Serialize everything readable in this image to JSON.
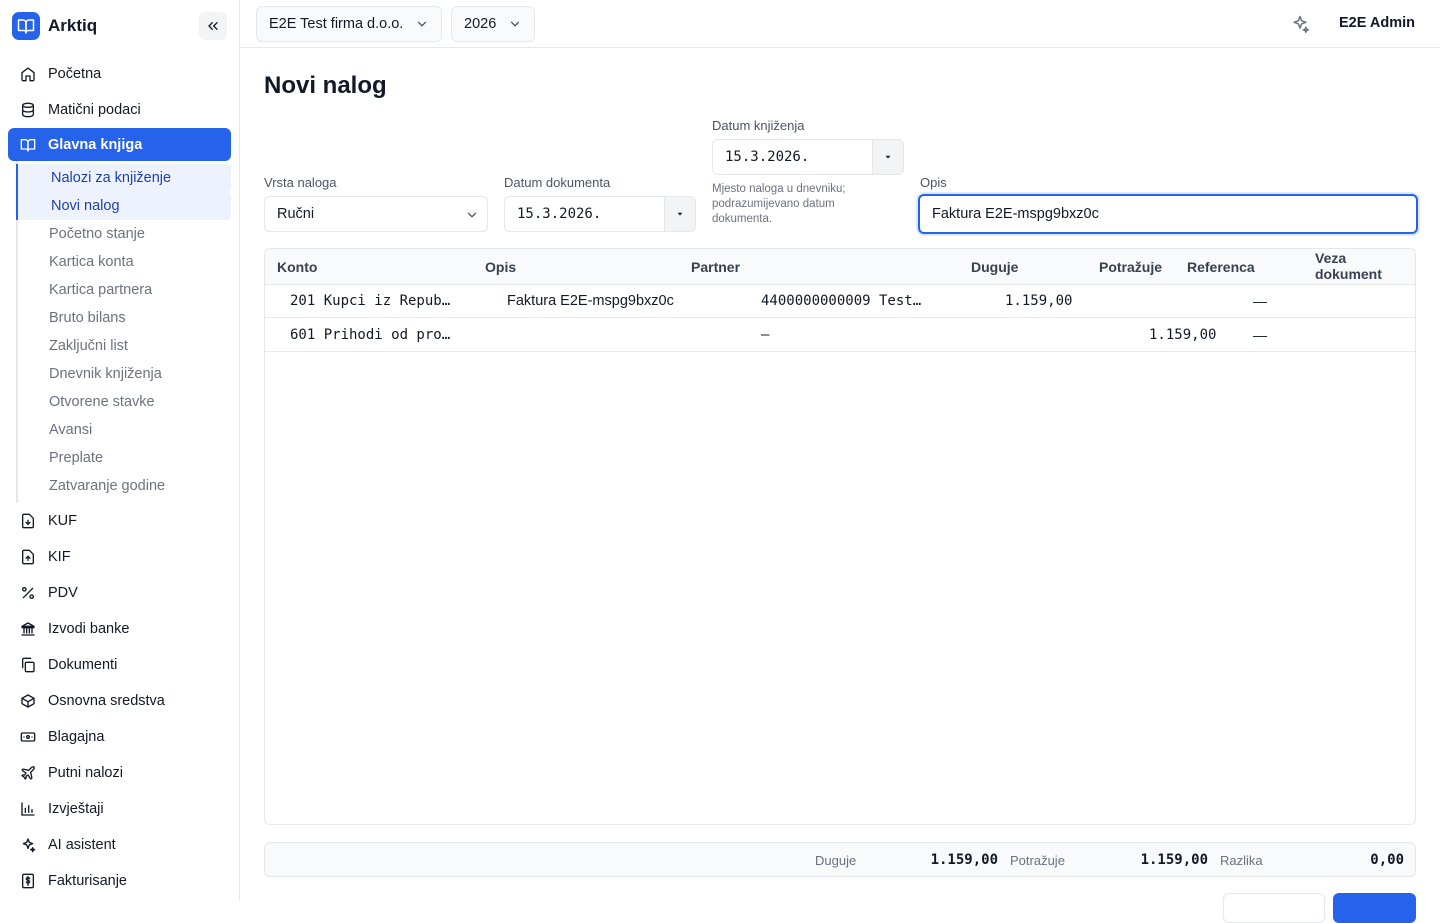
{
  "app": {
    "name": "Arktiq"
  },
  "topbar": {
    "company": "E2E Test firma d.o.o.",
    "year": "2026",
    "user": "E2E Admin"
  },
  "sidebar": {
    "items_top": [
      {
        "label": "Početna",
        "icon": "home-icon"
      },
      {
        "label": "Matični podaci",
        "icon": "database-icon"
      },
      {
        "label": "Glavna knjiga",
        "icon": "book-icon"
      }
    ],
    "sub": [
      "Nalozi za knjiženje",
      "Novi nalog",
      "Početno stanje",
      "Kartica konta",
      "Kartica partnera",
      "Bruto bilans",
      "Zaključni list",
      "Dnevnik knjiženja",
      "Otvorene stavke",
      "Avansi",
      "Preplate",
      "Zatvaranje godine"
    ],
    "items_bottom": [
      {
        "label": "KUF",
        "icon": "file-in-icon"
      },
      {
        "label": "KIF",
        "icon": "file-out-icon"
      },
      {
        "label": "PDV",
        "icon": "percent-icon"
      },
      {
        "label": "Izvodi banke",
        "icon": "bank-icon"
      },
      {
        "label": "Dokumenti",
        "icon": "documents-icon"
      },
      {
        "label": "Osnovna sredstva",
        "icon": "box-icon"
      },
      {
        "label": "Blagajna",
        "icon": "cash-icon"
      },
      {
        "label": "Putni nalozi",
        "icon": "plane-icon"
      },
      {
        "label": "Izvještaji",
        "icon": "bar-chart-icon"
      },
      {
        "label": "AI asistent",
        "icon": "sparkles-icon"
      },
      {
        "label": "Fakturisanje",
        "icon": "invoice-icon"
      }
    ]
  },
  "page": {
    "title": "Novi nalog"
  },
  "form": {
    "vrsta_label": "Vrsta naloga",
    "vrsta_value": "Ručni",
    "datum_dok_label": "Datum dokumenta",
    "datum_dok_value": "15.3.2026.",
    "datum_knj_label": "Datum knjiženja",
    "datum_knj_value": "15.3.2026.",
    "datum_knj_hint": "Mjesto naloga u dnevniku; podrazumijevano datum dokumenta.",
    "opis_label": "Opis",
    "opis_value": "Faktura E2E-mspg9bxz0c"
  },
  "table": {
    "headers": {
      "konto": "Konto",
      "opis": "Opis",
      "partner": "Partner",
      "duguje": "Duguje",
      "potrazuje": "Potražuje",
      "referenca": "Referenca",
      "veza": "Veza dokument"
    },
    "rows": [
      {
        "konto": "201 Kupci iz Repub…",
        "opis": "Faktura E2E-mspg9bxz0c",
        "partner": "4400000000009 Test…",
        "duguje": "1.159,00",
        "potrazuje": "",
        "referenca": "—"
      },
      {
        "konto": "601 Prihodi od pro…",
        "opis": "",
        "partner": "—",
        "duguje": "",
        "potrazuje": "1.159,00",
        "referenca": "—"
      }
    ]
  },
  "totals": {
    "duguje_label": "Duguje",
    "duguje_value": "1.159,00",
    "potrazuje_label": "Potražuje",
    "potrazuje_value": "1.159,00",
    "razlika_label": "Razlika",
    "razlika_value": "0,00"
  },
  "colors": {
    "accent": "#2563eb",
    "border": "#e5e7eb",
    "muted": "#6b7280"
  }
}
